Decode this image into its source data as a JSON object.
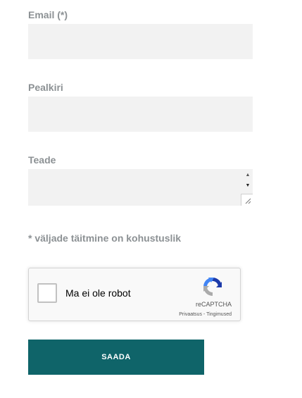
{
  "form": {
    "email": {
      "label": "Email (*)",
      "value": ""
    },
    "subject": {
      "label": "Pealkiri",
      "value": ""
    },
    "message": {
      "label": "Teade",
      "value": ""
    },
    "required_note": "* väljade täitmine on kohustuslik",
    "recaptcha": {
      "label": "Ma ei ole robot",
      "brand": "reCAPTCHA",
      "privacy_link": "Privaatsus",
      "separator": " - ",
      "terms_link": "Tingimused",
      "colors": {
        "blue": "#1c3aa9",
        "light_blue": "#4285f4",
        "gray": "#ababab"
      }
    },
    "submit_label": "SAADA",
    "colors": {
      "label": "#8c9194",
      "field_bg": "#f2f2f2",
      "button_bg": "#0f6469",
      "button_text": "#ffffff"
    }
  }
}
